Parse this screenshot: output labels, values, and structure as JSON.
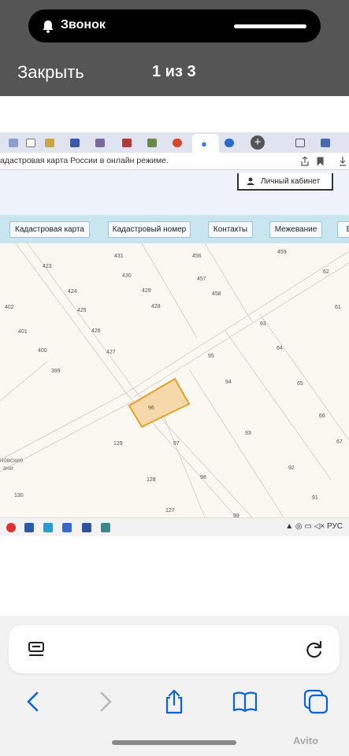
{
  "status": {
    "call_label": "Звонок"
  },
  "viewer": {
    "close_label": "Закрыть",
    "counter": "1 из 3"
  },
  "browser": {
    "address_text": "адастровая карта России в онлайн режиме."
  },
  "site": {
    "cabinet_label": "Личный кабинет",
    "nav": [
      {
        "label": "Кадастровая карта"
      },
      {
        "label": "Кадастровый номер"
      },
      {
        "label": "Контакты"
      },
      {
        "label": "Межевание"
      },
      {
        "label": "В"
      }
    ]
  },
  "map": {
    "parcel_labels": [
      "423",
      "424",
      "425",
      "426",
      "427",
      "401",
      "400",
      "399",
      "402",
      "431",
      "430",
      "429",
      "428",
      "456",
      "457",
      "458",
      "459",
      "62",
      "61",
      "63",
      "64",
      "65",
      "66",
      "67",
      "95",
      "94",
      "93",
      "92",
      "91",
      "96",
      "97",
      "98",
      "99",
      "129",
      "128",
      "127",
      "130"
    ],
    "highlight_parcel": "96",
    "place_label_line1": "новские",
    "place_label_line2": "ачи",
    "highlight_color": "#f0a830"
  },
  "taskbar": {
    "tray_text": "РУС"
  },
  "watermark": "Avito"
}
